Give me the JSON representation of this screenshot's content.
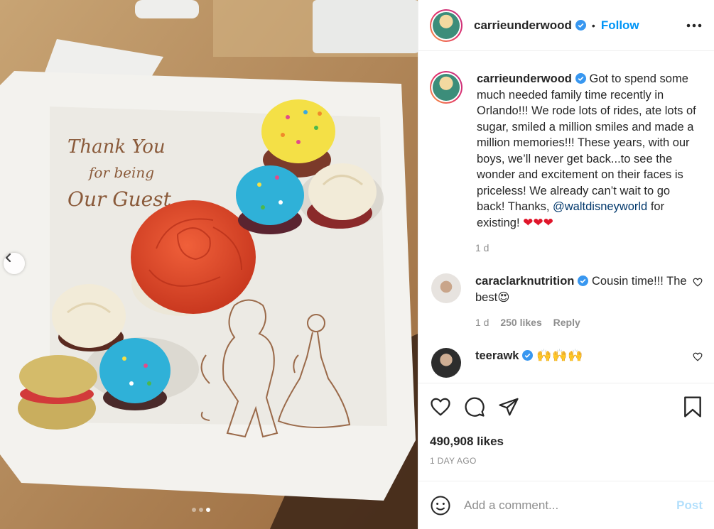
{
  "header": {
    "username": "carrieunderwood",
    "separator": "•",
    "follow_label": "Follow"
  },
  "caption": {
    "username": "carrieunderwood",
    "text": "Got to spend some much needed family time recently in Orlando!!! We rode lots of rides, ate lots of sugar, smiled a million smiles and made a million memories!!! These years, with our boys, we’ll never get back...to see the wonder and excitement on their faces is priceless! We already can’t wait to go back! Thanks, ",
    "mention": "@waltdisneyworld",
    "text_end": "for existing!",
    "hearts": "❤❤❤",
    "age": "1 d"
  },
  "comments": [
    {
      "username": "caraclarknutrition",
      "text": "Cousin time!!! The best",
      "emoji": "😍",
      "age": "1 d",
      "likes": "250 likes",
      "reply_label": "Reply"
    },
    {
      "username": "teerawk",
      "emoji": "🙌🙌🙌"
    }
  ],
  "plate_text": {
    "line1": "Thank You",
    "line2": "for being",
    "line3": "Our Guest"
  },
  "stats": {
    "likes": "490,908 likes",
    "date": "1 DAY AGO"
  },
  "composer": {
    "placeholder": "Add a comment...",
    "post_label": "Post"
  },
  "carousel": {
    "count": 3,
    "active_index": 2
  },
  "colors": {
    "accent": "#0095f6",
    "verified": "#3897f0",
    "heart": "#e0152a",
    "post_disabled": "#b2dffc"
  }
}
